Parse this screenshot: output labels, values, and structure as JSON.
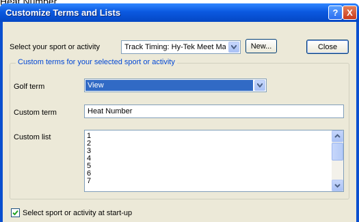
{
  "overflow_text": "Heat Number",
  "window": {
    "title": "Customize Terms and Lists",
    "help_glyph": "?",
    "close_glyph": "X"
  },
  "sport": {
    "label": "Select your sport or activity",
    "selected": "Track Timing: Hy-Tek Meet Mana",
    "new_button": "New...",
    "close_button": "Close"
  },
  "group": {
    "title": "Custom terms for your selected sport or activity",
    "golf_term_label": "Golf term",
    "golf_term_value": "View",
    "custom_term_label": "Custom term",
    "custom_term_value": "Heat Number",
    "custom_list_label": "Custom list",
    "custom_list_items": [
      "1",
      "2",
      "3",
      "4",
      "5",
      "6",
      "7"
    ]
  },
  "startup": {
    "checkbox_label": "Select sport or activity at start-up",
    "checked": true
  },
  "colors": {
    "titlebar": "#0b59e0",
    "selection": "#316ac5",
    "dialog_bg": "#ece9d8"
  }
}
